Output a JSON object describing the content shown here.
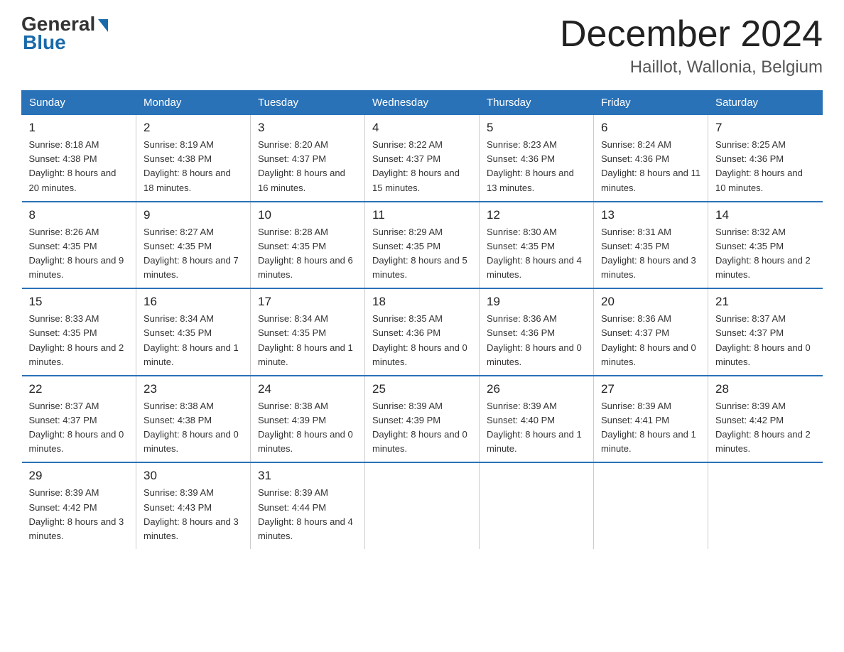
{
  "logo": {
    "text_general": "General",
    "text_blue": "Blue"
  },
  "header": {
    "month_year": "December 2024",
    "location": "Haillot, Wallonia, Belgium"
  },
  "days_of_week": [
    "Sunday",
    "Monday",
    "Tuesday",
    "Wednesday",
    "Thursday",
    "Friday",
    "Saturday"
  ],
  "weeks": [
    [
      {
        "num": "1",
        "sunrise": "8:18 AM",
        "sunset": "4:38 PM",
        "daylight": "8 hours and 20 minutes."
      },
      {
        "num": "2",
        "sunrise": "8:19 AM",
        "sunset": "4:38 PM",
        "daylight": "8 hours and 18 minutes."
      },
      {
        "num": "3",
        "sunrise": "8:20 AM",
        "sunset": "4:37 PM",
        "daylight": "8 hours and 16 minutes."
      },
      {
        "num": "4",
        "sunrise": "8:22 AM",
        "sunset": "4:37 PM",
        "daylight": "8 hours and 15 minutes."
      },
      {
        "num": "5",
        "sunrise": "8:23 AM",
        "sunset": "4:36 PM",
        "daylight": "8 hours and 13 minutes."
      },
      {
        "num": "6",
        "sunrise": "8:24 AM",
        "sunset": "4:36 PM",
        "daylight": "8 hours and 11 minutes."
      },
      {
        "num": "7",
        "sunrise": "8:25 AM",
        "sunset": "4:36 PM",
        "daylight": "8 hours and 10 minutes."
      }
    ],
    [
      {
        "num": "8",
        "sunrise": "8:26 AM",
        "sunset": "4:35 PM",
        "daylight": "8 hours and 9 minutes."
      },
      {
        "num": "9",
        "sunrise": "8:27 AM",
        "sunset": "4:35 PM",
        "daylight": "8 hours and 7 minutes."
      },
      {
        "num": "10",
        "sunrise": "8:28 AM",
        "sunset": "4:35 PM",
        "daylight": "8 hours and 6 minutes."
      },
      {
        "num": "11",
        "sunrise": "8:29 AM",
        "sunset": "4:35 PM",
        "daylight": "8 hours and 5 minutes."
      },
      {
        "num": "12",
        "sunrise": "8:30 AM",
        "sunset": "4:35 PM",
        "daylight": "8 hours and 4 minutes."
      },
      {
        "num": "13",
        "sunrise": "8:31 AM",
        "sunset": "4:35 PM",
        "daylight": "8 hours and 3 minutes."
      },
      {
        "num": "14",
        "sunrise": "8:32 AM",
        "sunset": "4:35 PM",
        "daylight": "8 hours and 2 minutes."
      }
    ],
    [
      {
        "num": "15",
        "sunrise": "8:33 AM",
        "sunset": "4:35 PM",
        "daylight": "8 hours and 2 minutes."
      },
      {
        "num": "16",
        "sunrise": "8:34 AM",
        "sunset": "4:35 PM",
        "daylight": "8 hours and 1 minute."
      },
      {
        "num": "17",
        "sunrise": "8:34 AM",
        "sunset": "4:35 PM",
        "daylight": "8 hours and 1 minute."
      },
      {
        "num": "18",
        "sunrise": "8:35 AM",
        "sunset": "4:36 PM",
        "daylight": "8 hours and 0 minutes."
      },
      {
        "num": "19",
        "sunrise": "8:36 AM",
        "sunset": "4:36 PM",
        "daylight": "8 hours and 0 minutes."
      },
      {
        "num": "20",
        "sunrise": "8:36 AM",
        "sunset": "4:37 PM",
        "daylight": "8 hours and 0 minutes."
      },
      {
        "num": "21",
        "sunrise": "8:37 AM",
        "sunset": "4:37 PM",
        "daylight": "8 hours and 0 minutes."
      }
    ],
    [
      {
        "num": "22",
        "sunrise": "8:37 AM",
        "sunset": "4:37 PM",
        "daylight": "8 hours and 0 minutes."
      },
      {
        "num": "23",
        "sunrise": "8:38 AM",
        "sunset": "4:38 PM",
        "daylight": "8 hours and 0 minutes."
      },
      {
        "num": "24",
        "sunrise": "8:38 AM",
        "sunset": "4:39 PM",
        "daylight": "8 hours and 0 minutes."
      },
      {
        "num": "25",
        "sunrise": "8:39 AM",
        "sunset": "4:39 PM",
        "daylight": "8 hours and 0 minutes."
      },
      {
        "num": "26",
        "sunrise": "8:39 AM",
        "sunset": "4:40 PM",
        "daylight": "8 hours and 1 minute."
      },
      {
        "num": "27",
        "sunrise": "8:39 AM",
        "sunset": "4:41 PM",
        "daylight": "8 hours and 1 minute."
      },
      {
        "num": "28",
        "sunrise": "8:39 AM",
        "sunset": "4:42 PM",
        "daylight": "8 hours and 2 minutes."
      }
    ],
    [
      {
        "num": "29",
        "sunrise": "8:39 AM",
        "sunset": "4:42 PM",
        "daylight": "8 hours and 3 minutes."
      },
      {
        "num": "30",
        "sunrise": "8:39 AM",
        "sunset": "4:43 PM",
        "daylight": "8 hours and 3 minutes."
      },
      {
        "num": "31",
        "sunrise": "8:39 AM",
        "sunset": "4:44 PM",
        "daylight": "8 hours and 4 minutes."
      },
      null,
      null,
      null,
      null
    ]
  ]
}
